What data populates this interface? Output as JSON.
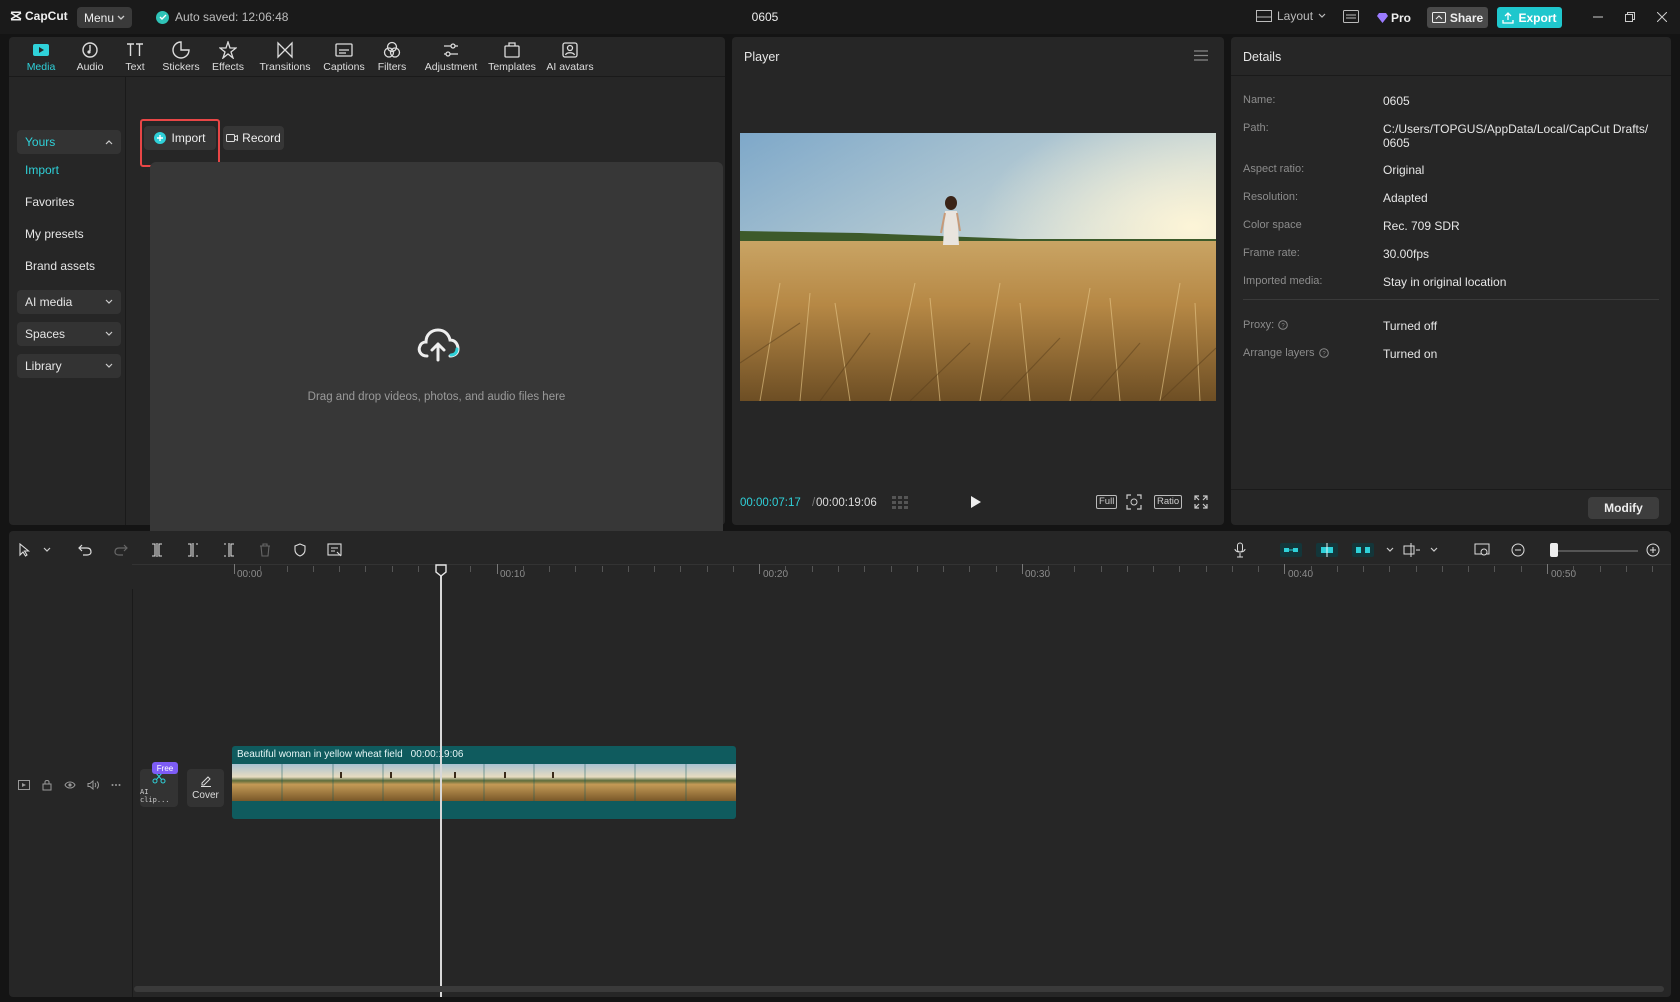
{
  "titlebar": {
    "app_name": "CapCut",
    "menu_label": "Menu",
    "autosave": "Auto saved: 12:06:48",
    "project_title": "0605",
    "layout_label": "Layout",
    "pro_label": "Pro",
    "share_label": "Share",
    "export_label": "Export"
  },
  "toolbar": {
    "tools": [
      {
        "label": "Media",
        "icon": "media-icon"
      },
      {
        "label": "Audio",
        "icon": "audio-icon"
      },
      {
        "label": "Text",
        "icon": "text-icon"
      },
      {
        "label": "Stickers",
        "icon": "stickers-icon"
      },
      {
        "label": "Effects",
        "icon": "effects-icon"
      },
      {
        "label": "Transitions",
        "icon": "transitions-icon"
      },
      {
        "label": "Captions",
        "icon": "captions-icon"
      },
      {
        "label": "Filters",
        "icon": "filters-icon"
      },
      {
        "label": "Adjustment",
        "icon": "adjustment-icon"
      },
      {
        "label": "Templates",
        "icon": "templates-icon"
      },
      {
        "label": "AI avatars",
        "icon": "ai-avatars-icon"
      }
    ]
  },
  "sidebar": {
    "yours": "Yours",
    "items": [
      "Import",
      "Favorites",
      "My presets",
      "Brand assets"
    ],
    "ai_media": "AI media",
    "spaces": "Spaces",
    "library": "Library"
  },
  "media": {
    "import_label": "Import",
    "record_label": "Record",
    "drop_text": "Drag and drop videos, photos, and audio files here"
  },
  "player": {
    "title": "Player",
    "current_time": "00:00:07:17",
    "separator": "/",
    "total_time": "00:00:19:06",
    "full_label": "Full",
    "ratio_label": "Ratio"
  },
  "details": {
    "title": "Details",
    "rows": [
      {
        "label": "Name:",
        "value": "0605"
      },
      {
        "label": "Path:",
        "value": "C:/Users/TOPGUS/AppData/Local/CapCut Drafts/ 0605"
      },
      {
        "label": "Aspect ratio:",
        "value": "Original"
      },
      {
        "label": "Resolution:",
        "value": "Adapted"
      },
      {
        "label": "Color space",
        "value": "Rec. 709 SDR"
      },
      {
        "label": "Frame rate:",
        "value": "30.00fps"
      },
      {
        "label": "Imported media:",
        "value": "Stay in original location"
      }
    ],
    "extra_rows": [
      {
        "label": "Proxy:",
        "value": "Turned off"
      },
      {
        "label": "Arrange layers",
        "value": "Turned on"
      }
    ],
    "modify_label": "Modify"
  },
  "timeline": {
    "ruler": [
      "00:00",
      "00:10",
      "00:20",
      "00:30",
      "00:40",
      "00:50"
    ],
    "clip_title": "Beautiful woman in yellow wheat field",
    "clip_duration": "00:00:19:06",
    "cover_label": "Cover",
    "free_badge": "Free",
    "ai_clip_label": "AI clip..."
  },
  "colors": {
    "accent": "#2fd1d9",
    "export": "#1fc7cd",
    "clip": "#0f5b5e",
    "highlight": "#e84646",
    "pro": "#7d5cf6"
  }
}
